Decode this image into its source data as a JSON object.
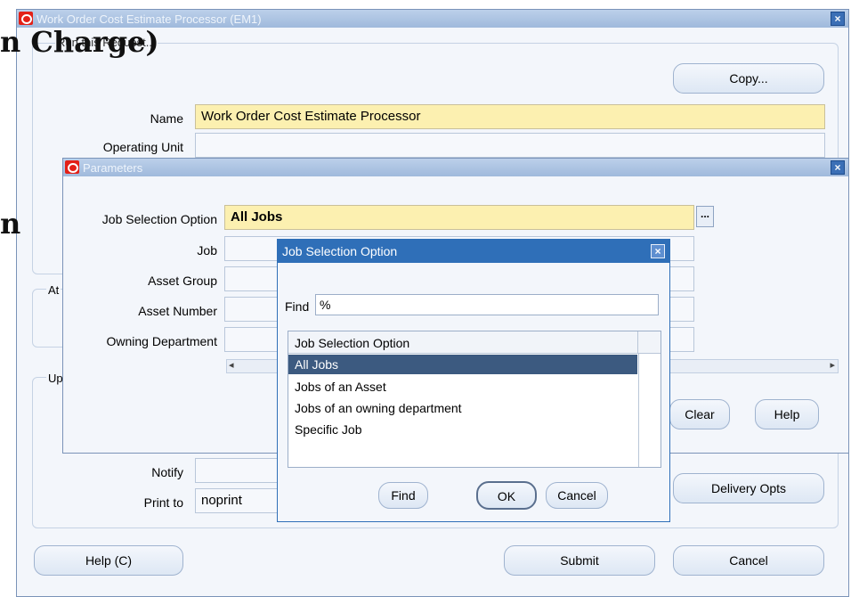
{
  "overlay": {
    "line1": "n Charge)",
    "line2": "n"
  },
  "main_window": {
    "title": "Work Order Cost Estimate Processor (EM1)",
    "group_run": "Run this Request...",
    "copy_button": "Copy...",
    "name_label": "Name",
    "name_value": "Work Order Cost Estimate Processor",
    "operating_unit_label": "Operating Unit",
    "operating_unit_value": "",
    "group_at": "At",
    "group_up": "Up",
    "notify_label": "Notify",
    "notify_value": "",
    "print_to_label": "Print to",
    "print_to_value": "noprint",
    "delivery_opts_button": "Delivery Opts",
    "help_button": "Help (C)",
    "submit_button": "Submit",
    "cancel_button": "Cancel"
  },
  "parameters_window": {
    "title": "Parameters",
    "fields": [
      {
        "label": "Job Selection Option",
        "value": "All Jobs"
      },
      {
        "label": "Job",
        "value": ""
      },
      {
        "label": "Asset Group",
        "value": ""
      },
      {
        "label": "Asset Number",
        "value": ""
      },
      {
        "label": "Owning Department",
        "value": ""
      }
    ],
    "lov_button": "...",
    "clear_button": "Clear",
    "help_button": "Help"
  },
  "lov_dialog": {
    "title": "Job Selection Option",
    "find_label": "Find",
    "find_value": "%",
    "column_header": "Job Selection Option",
    "options": [
      "All Jobs",
      "Jobs of an Asset",
      "Jobs of an owning department",
      "Specific Job"
    ],
    "selected_index": 0,
    "find_button": "Find",
    "ok_button": "OK",
    "cancel_button": "Cancel"
  },
  "colors": {
    "title_gradient": "#a9c1e2",
    "required_field": "#fcf0b0",
    "selected_row": "#3c5a80",
    "dialog_title": "#2f6fb8"
  }
}
